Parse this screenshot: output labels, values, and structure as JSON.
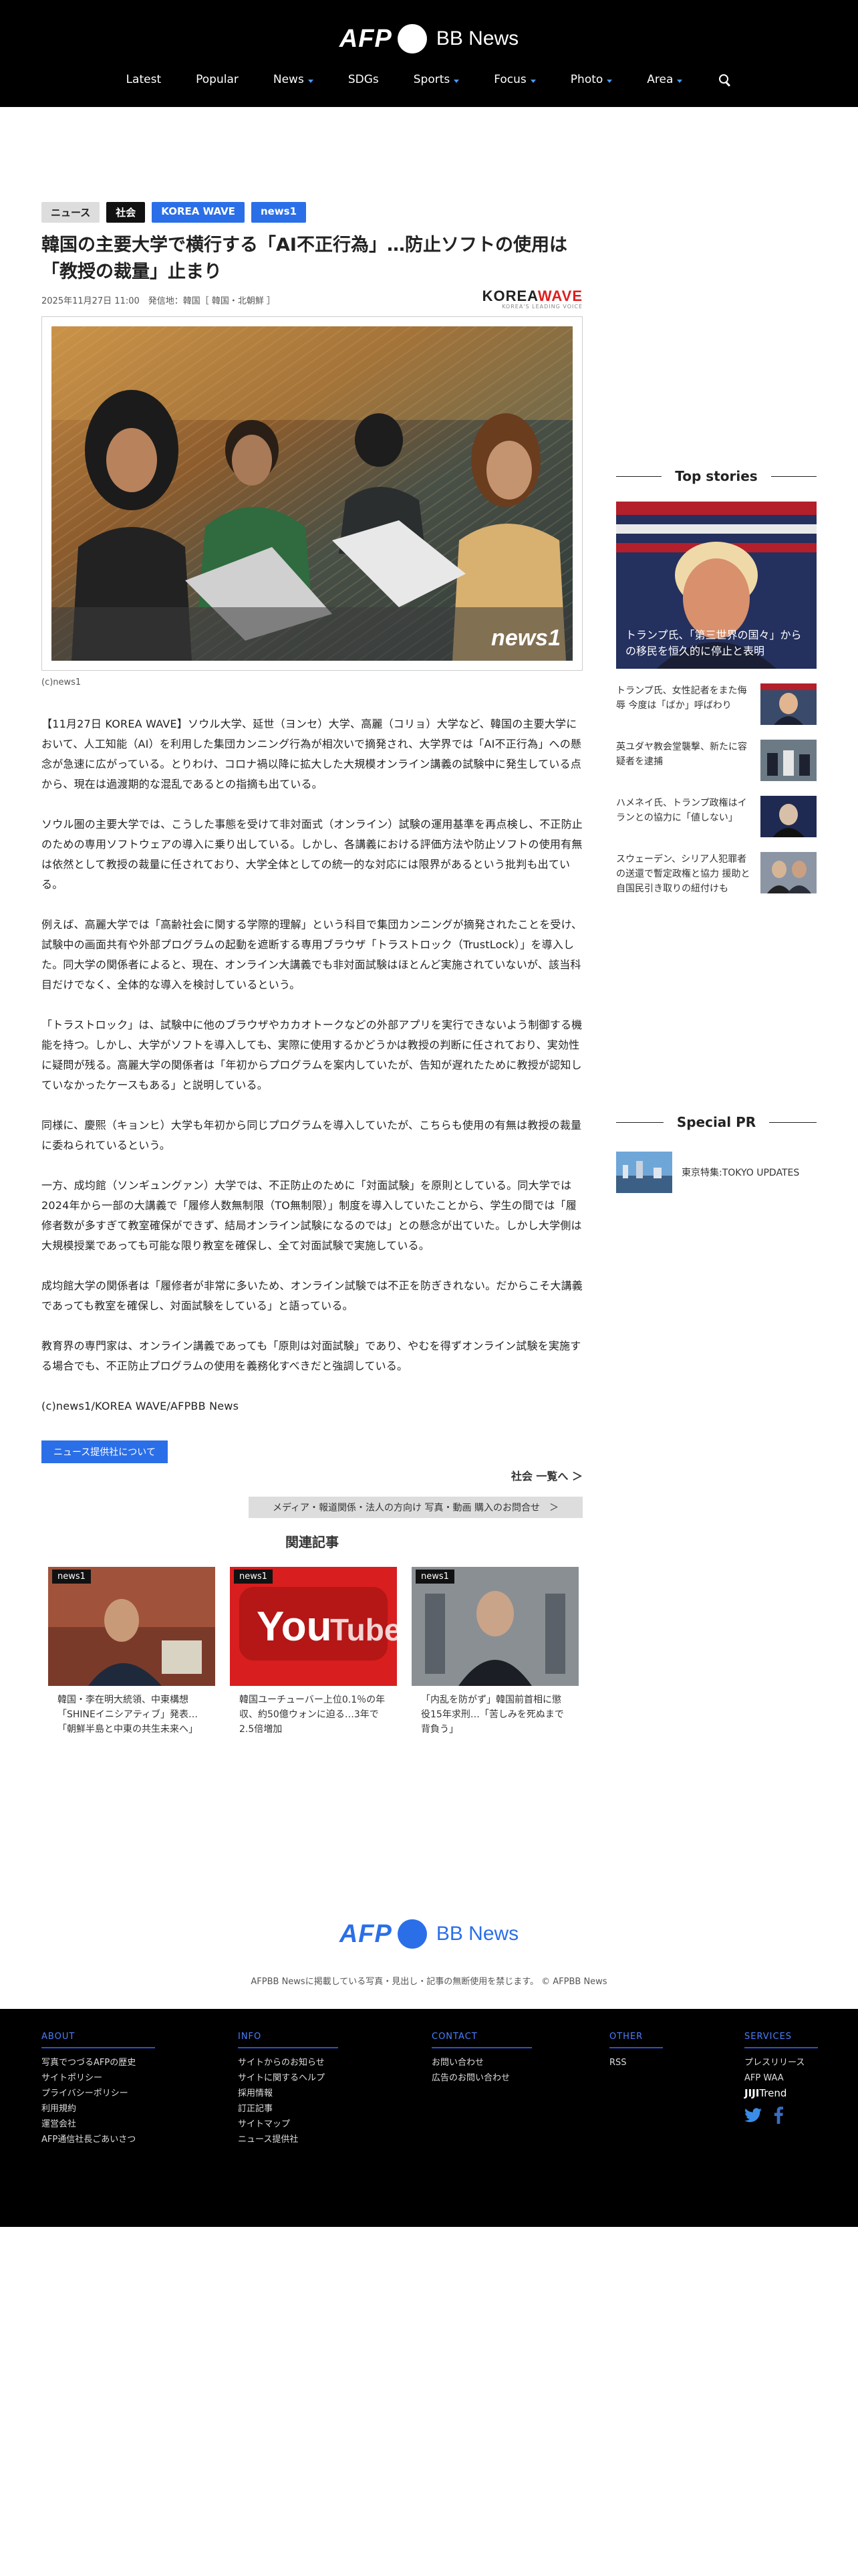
{
  "header": {
    "logo_afp": "AFP",
    "logo_bb": "BB News",
    "nav": [
      {
        "label": "Latest",
        "dropdown": false
      },
      {
        "label": "Popular",
        "dropdown": false
      },
      {
        "label": "News",
        "dropdown": true
      },
      {
        "label": "SDGs",
        "dropdown": false
      },
      {
        "label": "Sports",
        "dropdown": true
      },
      {
        "label": "Focus",
        "dropdown": true
      },
      {
        "label": "Photo",
        "dropdown": true
      },
      {
        "label": "Area",
        "dropdown": true
      }
    ],
    "search_icon": "search-icon"
  },
  "article": {
    "tags": [
      "ニュース",
      "社会",
      "KOREA WAVE",
      "news1"
    ],
    "title": "韓国の主要大学で横行する「AI不正行為」…防止ソフトの使用は「教授の裁量」止まり",
    "date": "2025年11月27日 11:00",
    "origin": "発信地：韓国［ 韓国・北朝鮮 ］",
    "source_logo_main": "KOREA",
    "source_logo_accent": "WAVE",
    "source_logo_sub": "KOREA'S LEADING VOICE",
    "photo_watermark": "news1",
    "photo_credit": "(c)news1",
    "paragraphs": [
      "【11月27日 KOREA WAVE】ソウル大学、延世（ヨンセ）大学、高麗（コリョ）大学など、韓国の主要大学において、人工知能（AI）を利用した集団カンニング行為が相次いで摘発され、大学界では「AI不正行為」への懸念が急速に広がっている。とりわけ、コロナ禍以降に拡大した大規模オンライン講義の試験中に発生している点から、現在は過渡期的な混乱であるとの指摘も出ている。",
      "ソウル圏の主要大学では、こうした事態を受けて非対面式（オンライン）試験の運用基準を再点検し、不正防止のための専用ソフトウェアの導入に乗り出している。しかし、各講義における評価方法や防止ソフトの使用有無は依然として教授の裁量に任されており、大学全体としての統一的な対応には限界があるという批判も出ている。",
      "例えば、高麗大学では「高齢社会に関する学際的理解」という科目で集団カンニングが摘発されたことを受け、試験中の画面共有や外部プログラムの起動を遮断する専用ブラウザ「トラストロック（TrustLock）」を導入した。同大学の関係者によると、現在、オンライン大講義でも非対面試験はほとんど実施されていないが、該当科目だけでなく、全体的な導入を検討しているという。",
      "「トラストロック」は、試験中に他のブラウザやカカオトークなどの外部アプリを実行できないよう制御する機能を持つ。しかし、大学がソフトを導入しても、実際に使用するかどうかは教授の判断に任されており、実効性に疑問が残る。高麗大学の関係者は「年初からプログラムを案内していたが、告知が遅れたために教授が認知していなかったケースもある」と説明している。",
      "同様に、慶熙（キョンヒ）大学も年初から同じプログラムを導入していたが、こちらも使用の有無は教授の裁量に委ねられているという。",
      "一方、成均館（ソンギュングァン）大学では、不正防止のために「対面試験」を原則としている。同大学では2024年から一部の大講義で「履修人数無制限（TO無制限）」制度を導入していたことから、学生の間では「履修者数が多すぎて教室確保ができず、結局オンライン試験になるのでは」との懸念が出ていた。しかし大学側は大規模授業であっても可能な限り教室を確保し、全て対面試験で実施している。",
      "成均館大学の関係者は「履修者が非常に多いため、オンライン試験では不正を防ぎきれない。だからこそ大講義であっても教室を確保し、対面試験をしている」と語っている。",
      "教育界の専門家は、オンライン講義であっても「原則は対面試験」であり、やむを得ずオンライン試験を実施する場合でも、不正防止プログラムの使用を義務化すべきだと強調している。",
      "(c)news1/KOREA WAVE/AFPBB News"
    ],
    "provider_button": "ニュース提供社について",
    "more_link": "社会 一覧へ ＞",
    "contact_bar": "メディア・報道関係・法人の方向け 写真・動画 購入のお問合せ　＞",
    "related_title": "関連記事",
    "related": [
      {
        "badge": "news1",
        "text": "韓国・李在明大統領、中東構想「SHINEイニシアティブ」発表…「朝鮮半島と中東の共生未来へ」"
      },
      {
        "badge": "news1",
        "text": "韓国ユーチューバー上位0.1％の年収、約50億ウォンに迫る…3年で2.5倍増加"
      },
      {
        "badge": "news1",
        "text": "「内乱を防がず」韓国前首相に懲役15年求刑…「苦しみを死ぬまで背負う」"
      }
    ]
  },
  "sidebar": {
    "top_stories_title": "Top stories",
    "top_main_caption": "トランプ氏、「第三世界の国々」からの移民を恒久的に停止と表明",
    "top_items": [
      "トランプ氏、女性記者をまた侮辱 今度は「ばか」呼ばわり",
      "英ユダヤ教会堂襲撃、新たに容疑者を逮捕",
      "ハメネイ氏、トランプ政権はイランとの協力に「値しない」",
      "スウェーデン、シリア人犯罪者の送還で暫定政権と協力 援助と自国民引き取りの紐付けも"
    ],
    "special_pr_title": "Special PR",
    "pr_item": "東京特集:TOKYO UPDATES"
  },
  "footer": {
    "logo_afp": "AFP",
    "logo_bb": "BB News",
    "copyright": "AFPBB Newsに掲載している写真・見出し・記事の無断使用を禁じます。 © AFPBB News",
    "columns": [
      {
        "head": "ABOUT",
        "links": [
          "写真でつづるAFPの歴史",
          "サイトポリシー",
          "プライバシーポリシー",
          "利用規約",
          "運営会社",
          "AFP通信社長ごあいさつ"
        ]
      },
      {
        "head": "INFO",
        "links": [
          "サイトからのお知らせ",
          "サイトに関するヘルプ",
          "採用情報",
          "訂正記事",
          "サイトマップ",
          "ニュース提供社"
        ]
      },
      {
        "head": "CONTACT",
        "links": [
          "お問い合わせ",
          "広告のお問い合わせ"
        ]
      },
      {
        "head": "OTHER",
        "links": [
          "RSS"
        ]
      },
      {
        "head": "SERVICES",
        "links": [
          "プレスリリース",
          "AFP WAA"
        ]
      }
    ],
    "jiji_main": "JIJI",
    "jiji_trend": "Trend",
    "social": [
      "twitter-icon",
      "facebook-icon"
    ]
  }
}
